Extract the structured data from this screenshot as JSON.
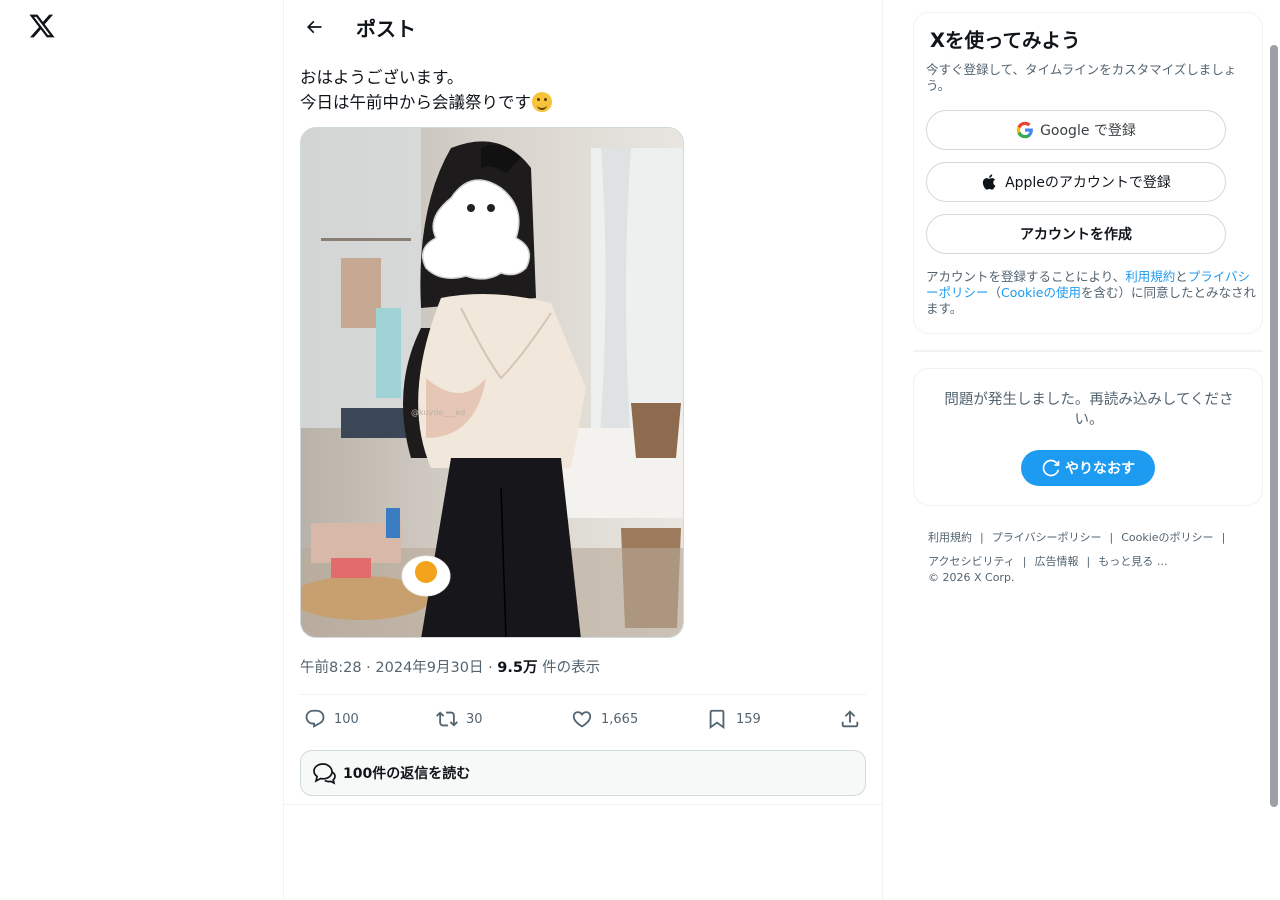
{
  "nav": {
    "logo_icon": "x-logo-icon"
  },
  "header": {
    "title": "ポスト"
  },
  "post": {
    "text_line1": "おはようございます。",
    "text_line2": "今日は午前中から会議祭りです",
    "time": "午前8:28",
    "date": "2024年9月30日",
    "views_count": "9.5万",
    "views_label": "件の表示",
    "replies": "100",
    "reposts": "30",
    "likes": "1,665",
    "bookmarks": "159",
    "read_replies_label": "100件の返信を読む",
    "image_watermark": "@kuyde___ed"
  },
  "signup": {
    "title": "Xを使ってみよう",
    "description": "今すぐ登録して、タイムラインをカスタマイズしましょう。",
    "google_button": "Google で登録",
    "apple_button": "Appleのアカウントで登録",
    "create_button": "アカウントを作成",
    "legal_prefix": "アカウントを登録することにより、",
    "terms_link": "利用規約",
    "legal_and": "と",
    "privacy_link": "プライバシーポリシー",
    "legal_paren_open": "（",
    "cookie_link": "Cookieの使用",
    "legal_suffix": "を含む）に同意したとみなされます。"
  },
  "error": {
    "message": "問題が発生しました。再読み込みしてください。",
    "retry_button": "やりなおす"
  },
  "footer": {
    "links": [
      "利用規約",
      "プライバシーポリシー",
      "Cookieのポリシー",
      "アクセシビリティ",
      "広告情報",
      "もっと見る …"
    ],
    "copyright": "© 2026 X Corp."
  },
  "colors": {
    "accent": "#1d9bf0",
    "text": "#0f1419",
    "muted": "#536471"
  }
}
